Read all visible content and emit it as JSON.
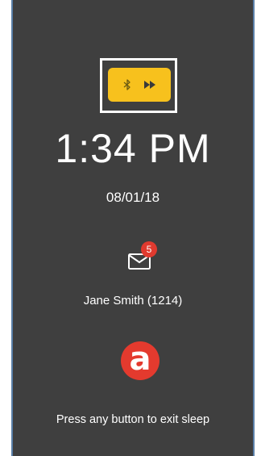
{
  "colors": {
    "screen_bg": "#3f3f3f",
    "accent_yellow": "#f7c11d",
    "badge_red": "#e03a2f",
    "logo_red": "#e43a2e",
    "text": "#ffffff"
  },
  "controls": {
    "left_icon": "bluetooth-icon",
    "right_icon": "fast-forward-icon"
  },
  "clock": {
    "time": "1:34 PM",
    "date": "08/01/18"
  },
  "messages": {
    "icon": "envelope-icon",
    "unread_count": "5"
  },
  "user": {
    "name": "Jane Smith (1214)"
  },
  "logo": {
    "letter": "a",
    "icon": "brand-logo-icon"
  },
  "footer": {
    "hint": "Press any button to exit sleep"
  }
}
